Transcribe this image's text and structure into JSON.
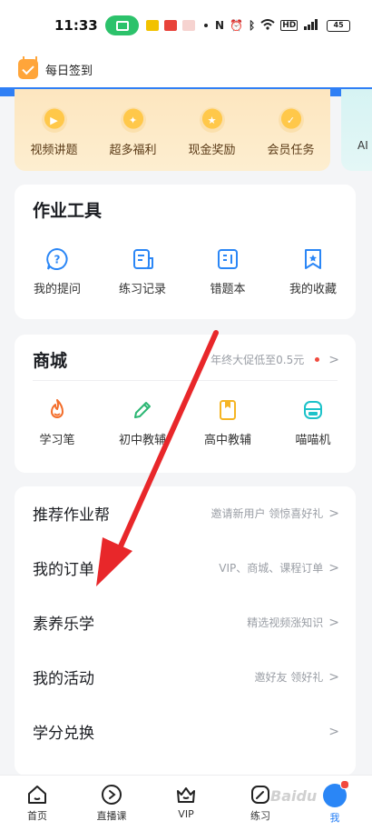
{
  "status_bar": {
    "time": "11:33",
    "battery": "45"
  },
  "checkin": {
    "label": "每日签到"
  },
  "rewards": {
    "items": [
      {
        "label": "视频讲题"
      },
      {
        "label": "超多福利"
      },
      {
        "label": "现金奖励"
      },
      {
        "label": "会员任务"
      }
    ],
    "peek_label": "AI"
  },
  "tools": {
    "title": "作业工具",
    "items": [
      {
        "label": "我的提问",
        "icon": "question-bubble-icon"
      },
      {
        "label": "练习记录",
        "icon": "practice-record-icon"
      },
      {
        "label": "错题本",
        "icon": "mistake-book-icon"
      },
      {
        "label": "我的收藏",
        "icon": "bookmark-icon"
      }
    ]
  },
  "shop": {
    "title": "商城",
    "promo": "年终大促低至0.5元",
    "items": [
      {
        "label": "学习笔",
        "icon": "flame-pen-icon"
      },
      {
        "label": "初中教辅",
        "icon": "pencil-icon"
      },
      {
        "label": "高中教辅",
        "icon": "book-icon"
      },
      {
        "label": "喵喵机",
        "icon": "printer-icon"
      }
    ]
  },
  "menu": {
    "items": [
      {
        "title": "推荐作业帮",
        "hint": "邀请新用户 领惊喜好礼"
      },
      {
        "title": "我的订单",
        "hint": "VIP、商城、课程订单"
      },
      {
        "title": "素养乐学",
        "hint": "精选视频涨知识"
      },
      {
        "title": "我的活动",
        "hint": "邀好友 领好礼"
      },
      {
        "title": "学分兑换",
        "hint": ""
      }
    ]
  },
  "tabbar": {
    "items": [
      {
        "label": "首页",
        "icon": "home-icon"
      },
      {
        "label": "直播课",
        "icon": "live-course-icon"
      },
      {
        "label": "VIP",
        "icon": "vip-crown-icon"
      },
      {
        "label": "练习",
        "icon": "practice-icon"
      },
      {
        "label": "我",
        "icon": "avatar"
      }
    ],
    "active": "我"
  },
  "colors": {
    "accent": "#1f7bf5",
    "arrow": "#e8272a",
    "tool_icon": "#2a86f6",
    "promo_dot": "#f04a3e"
  },
  "watermark": "Baidu"
}
